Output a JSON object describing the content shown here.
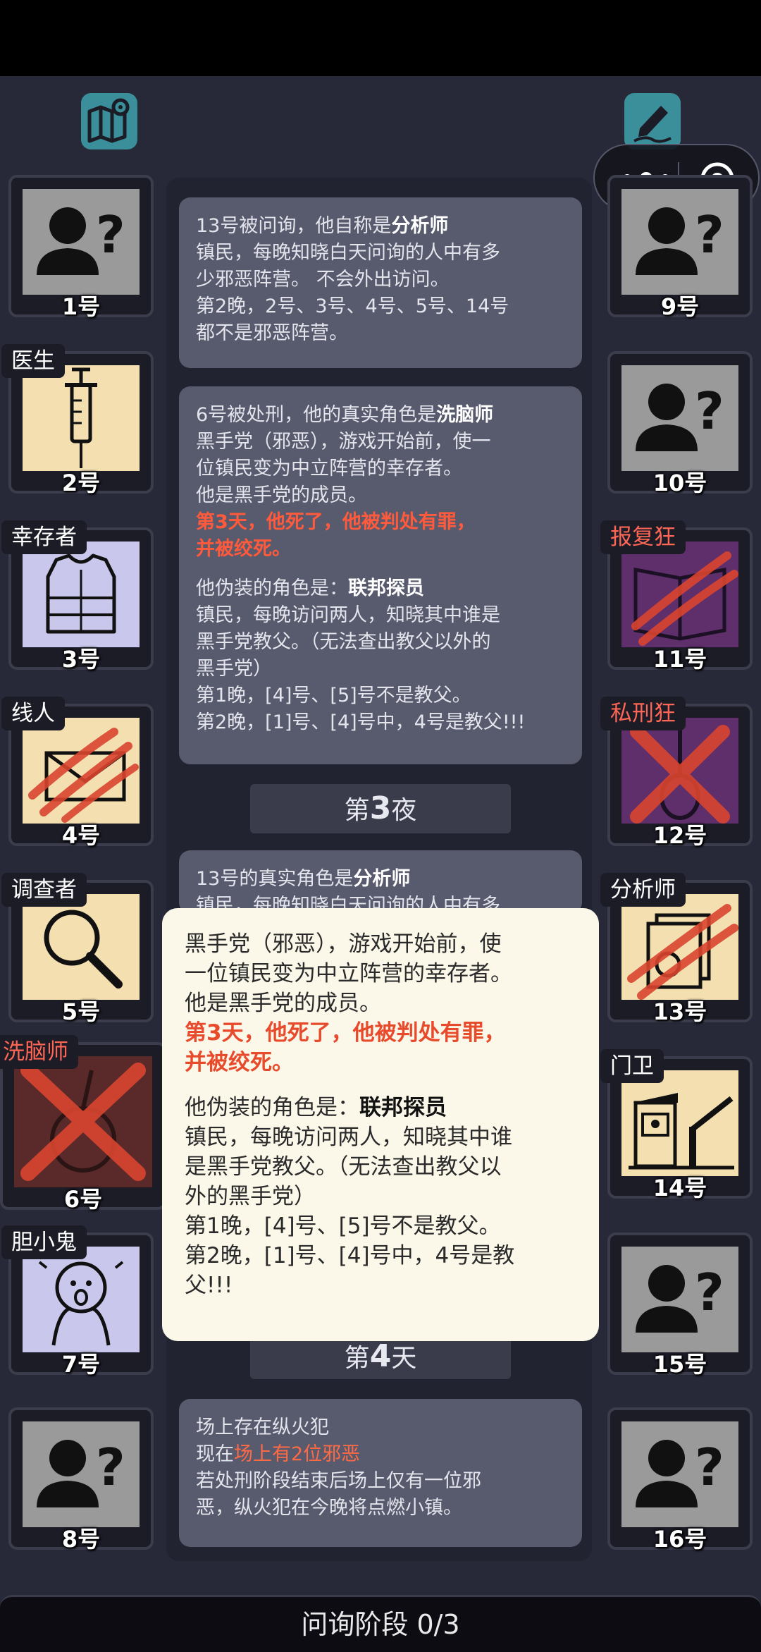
{
  "top": {
    "map_icon": "map-icon",
    "edit_icon": "pen-icon",
    "capsule_more": "more-icon",
    "capsule_close": "target-icon"
  },
  "cards": {
    "c1": {
      "l1a": "13号被问询，他自称是",
      "l1b": "分析师",
      "l2": "镇民，每晚知晓白天问询的人中有多",
      "l3": "少邪恶阵营。 不会外出访问。",
      "l4": "第2晚，2号、3号、4号、5号、14号",
      "l5": "都不是邪恶阵营。"
    },
    "c2": {
      "l1a": "6号被处刑，他的真实角色是",
      "l1b": "洗脑师",
      "l2": "黑手党（邪恶），游戏开始前，使一",
      "l3": "位镇民变为中立阵营的幸存者。",
      "l4": "他是黑手党的成员。",
      "l5": "第3天，他死了，他被判处有罪，",
      "l6": "并被绞死。",
      "l7a": "他伪装的角色是：",
      "l7b": "联邦探员",
      "l8": "镇民，每晚访问两人，知晓其中谁是",
      "l9": "黑手党教父。（无法查出教父以外的",
      "l10": "黑手党）",
      "l11": "第1晚，[4]号、[5]号不是教父。",
      "l12": "第2晚，[1]号、[4]号中，4号是教父!!!"
    },
    "c3": {
      "l1a": "13号的真实角色是",
      "l1b": "分析师",
      "l2": "镇民，每晚知晓白天问询的人中有多"
    },
    "c4": {
      "l1": "场上存在纵火犯",
      "l2a": "现在",
      "l2b": "场上有2位邪恶",
      "l3": "若处刑阶段结束后场上仅有一位邪",
      "l4": "恶，纵火犯在今晚将点燃小镇。"
    }
  },
  "separators": {
    "night3_pre": "第",
    "night3_num": "3",
    "night3_post": "夜",
    "day4_pre": "第",
    "day4_num": "4",
    "day4_post": "天"
  },
  "players": {
    "p1": {
      "num": "1号",
      "role": ""
    },
    "p2": {
      "num": "2号",
      "role": "医生"
    },
    "p3": {
      "num": "3号",
      "role": "幸存者"
    },
    "p4": {
      "num": "4号",
      "role": "线人"
    },
    "p5": {
      "num": "5号",
      "role": "调查者"
    },
    "p6": {
      "num": "6号",
      "role": "洗脑师"
    },
    "p7": {
      "num": "7号",
      "role": "胆小鬼"
    },
    "p8": {
      "num": "8号",
      "role": ""
    },
    "p9": {
      "num": "9号",
      "role": ""
    },
    "p10": {
      "num": "10号",
      "role": ""
    },
    "p11": {
      "num": "11号",
      "role": "报复狂"
    },
    "p12": {
      "num": "12号",
      "role": "私刑狂"
    },
    "p13": {
      "num": "13号",
      "role": "分析师"
    },
    "p14": {
      "num": "14号",
      "role": "门卫"
    },
    "p15": {
      "num": "15号",
      "role": ""
    },
    "p16": {
      "num": "16号",
      "role": ""
    }
  },
  "popup": {
    "l1": "黑手党（邪恶），游戏开始前，使",
    "l2": "一位镇民变为中立阵营的幸存者。",
    "l3": "他是黑手党的成员。",
    "l4": "第3天，他死了，他被判处有罪，",
    "l5": "并被绞死。",
    "l6a": "他伪装的角色是：",
    "l6b": "联邦探员",
    "l7": "镇民，每晚访问两人，知晓其中谁",
    "l8": "是黑手党教父。（无法查出教父以",
    "l9": "外的黑手党）",
    "l10": "第1晚，[4]号、[5]号不是教父。",
    "l11": "第2晚，[1]号、[4]号中，4号是教",
    "l12": "父!!!"
  },
  "bottom": {
    "phase": "问询阶段 0/3"
  },
  "colors": {
    "background": "#272838",
    "card": "#585a6e",
    "accent_red": "#ff5a3c",
    "popup": "#fbf8ea",
    "teal": "#3a8f9a"
  }
}
